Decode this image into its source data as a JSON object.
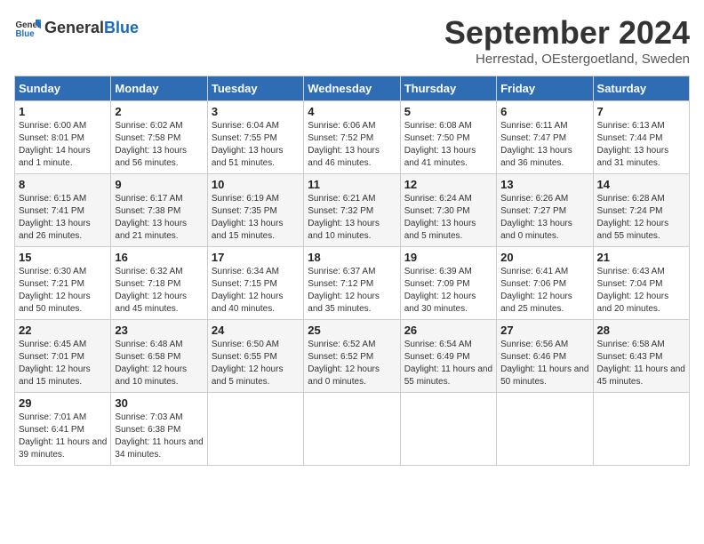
{
  "header": {
    "logo_general": "General",
    "logo_blue": "Blue",
    "month_title": "September 2024",
    "location": "Herrestad, OEstergoetland, Sweden"
  },
  "weekdays": [
    "Sunday",
    "Monday",
    "Tuesday",
    "Wednesday",
    "Thursday",
    "Friday",
    "Saturday"
  ],
  "weeks": [
    [
      {
        "day": "1",
        "sunrise": "6:00 AM",
        "sunset": "8:01 PM",
        "daylight": "14 hours and 1 minute."
      },
      {
        "day": "2",
        "sunrise": "6:02 AM",
        "sunset": "7:58 PM",
        "daylight": "13 hours and 56 minutes."
      },
      {
        "day": "3",
        "sunrise": "6:04 AM",
        "sunset": "7:55 PM",
        "daylight": "13 hours and 51 minutes."
      },
      {
        "day": "4",
        "sunrise": "6:06 AM",
        "sunset": "7:52 PM",
        "daylight": "13 hours and 46 minutes."
      },
      {
        "day": "5",
        "sunrise": "6:08 AM",
        "sunset": "7:50 PM",
        "daylight": "13 hours and 41 minutes."
      },
      {
        "day": "6",
        "sunrise": "6:11 AM",
        "sunset": "7:47 PM",
        "daylight": "13 hours and 36 minutes."
      },
      {
        "day": "7",
        "sunrise": "6:13 AM",
        "sunset": "7:44 PM",
        "daylight": "13 hours and 31 minutes."
      }
    ],
    [
      {
        "day": "8",
        "sunrise": "6:15 AM",
        "sunset": "7:41 PM",
        "daylight": "13 hours and 26 minutes."
      },
      {
        "day": "9",
        "sunrise": "6:17 AM",
        "sunset": "7:38 PM",
        "daylight": "13 hours and 21 minutes."
      },
      {
        "day": "10",
        "sunrise": "6:19 AM",
        "sunset": "7:35 PM",
        "daylight": "13 hours and 15 minutes."
      },
      {
        "day": "11",
        "sunrise": "6:21 AM",
        "sunset": "7:32 PM",
        "daylight": "13 hours and 10 minutes."
      },
      {
        "day": "12",
        "sunrise": "6:24 AM",
        "sunset": "7:30 PM",
        "daylight": "13 hours and 5 minutes."
      },
      {
        "day": "13",
        "sunrise": "6:26 AM",
        "sunset": "7:27 PM",
        "daylight": "13 hours and 0 minutes."
      },
      {
        "day": "14",
        "sunrise": "6:28 AM",
        "sunset": "7:24 PM",
        "daylight": "12 hours and 55 minutes."
      }
    ],
    [
      {
        "day": "15",
        "sunrise": "6:30 AM",
        "sunset": "7:21 PM",
        "daylight": "12 hours and 50 minutes."
      },
      {
        "day": "16",
        "sunrise": "6:32 AM",
        "sunset": "7:18 PM",
        "daylight": "12 hours and 45 minutes."
      },
      {
        "day": "17",
        "sunrise": "6:34 AM",
        "sunset": "7:15 PM",
        "daylight": "12 hours and 40 minutes."
      },
      {
        "day": "18",
        "sunrise": "6:37 AM",
        "sunset": "7:12 PM",
        "daylight": "12 hours and 35 minutes."
      },
      {
        "day": "19",
        "sunrise": "6:39 AM",
        "sunset": "7:09 PM",
        "daylight": "12 hours and 30 minutes."
      },
      {
        "day": "20",
        "sunrise": "6:41 AM",
        "sunset": "7:06 PM",
        "daylight": "12 hours and 25 minutes."
      },
      {
        "day": "21",
        "sunrise": "6:43 AM",
        "sunset": "7:04 PM",
        "daylight": "12 hours and 20 minutes."
      }
    ],
    [
      {
        "day": "22",
        "sunrise": "6:45 AM",
        "sunset": "7:01 PM",
        "daylight": "12 hours and 15 minutes."
      },
      {
        "day": "23",
        "sunrise": "6:48 AM",
        "sunset": "6:58 PM",
        "daylight": "12 hours and 10 minutes."
      },
      {
        "day": "24",
        "sunrise": "6:50 AM",
        "sunset": "6:55 PM",
        "daylight": "12 hours and 5 minutes."
      },
      {
        "day": "25",
        "sunrise": "6:52 AM",
        "sunset": "6:52 PM",
        "daylight": "12 hours and 0 minutes."
      },
      {
        "day": "26",
        "sunrise": "6:54 AM",
        "sunset": "6:49 PM",
        "daylight": "11 hours and 55 minutes."
      },
      {
        "day": "27",
        "sunrise": "6:56 AM",
        "sunset": "6:46 PM",
        "daylight": "11 hours and 50 minutes."
      },
      {
        "day": "28",
        "sunrise": "6:58 AM",
        "sunset": "6:43 PM",
        "daylight": "11 hours and 45 minutes."
      }
    ],
    [
      {
        "day": "29",
        "sunrise": "7:01 AM",
        "sunset": "6:41 PM",
        "daylight": "11 hours and 39 minutes."
      },
      {
        "day": "30",
        "sunrise": "7:03 AM",
        "sunset": "6:38 PM",
        "daylight": "11 hours and 34 minutes."
      },
      null,
      null,
      null,
      null,
      null
    ]
  ]
}
